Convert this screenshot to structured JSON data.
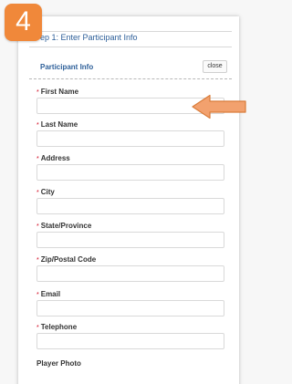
{
  "badge": {
    "number": "4"
  },
  "step": {
    "title": "ep 1: Enter Participant Info"
  },
  "section": {
    "title": "Participant Info",
    "close_label": "close"
  },
  "fields": [
    {
      "label": "First Name",
      "required": true
    },
    {
      "label": "Last Name",
      "required": true
    },
    {
      "label": "Address",
      "required": true
    },
    {
      "label": "City",
      "required": true
    },
    {
      "label": "State/Province",
      "required": true
    },
    {
      "label": "Zip/Postal Code",
      "required": true
    },
    {
      "label": "Email",
      "required": true
    },
    {
      "label": "Telephone",
      "required": true
    }
  ],
  "photo": {
    "label": "Player Photo"
  },
  "required_marker": "*",
  "colors": {
    "accent_blue": "#2d5f99",
    "badge_orange": "#f0883a",
    "arrow_orange": "#f2a16e",
    "required_red": "#d0021b"
  }
}
